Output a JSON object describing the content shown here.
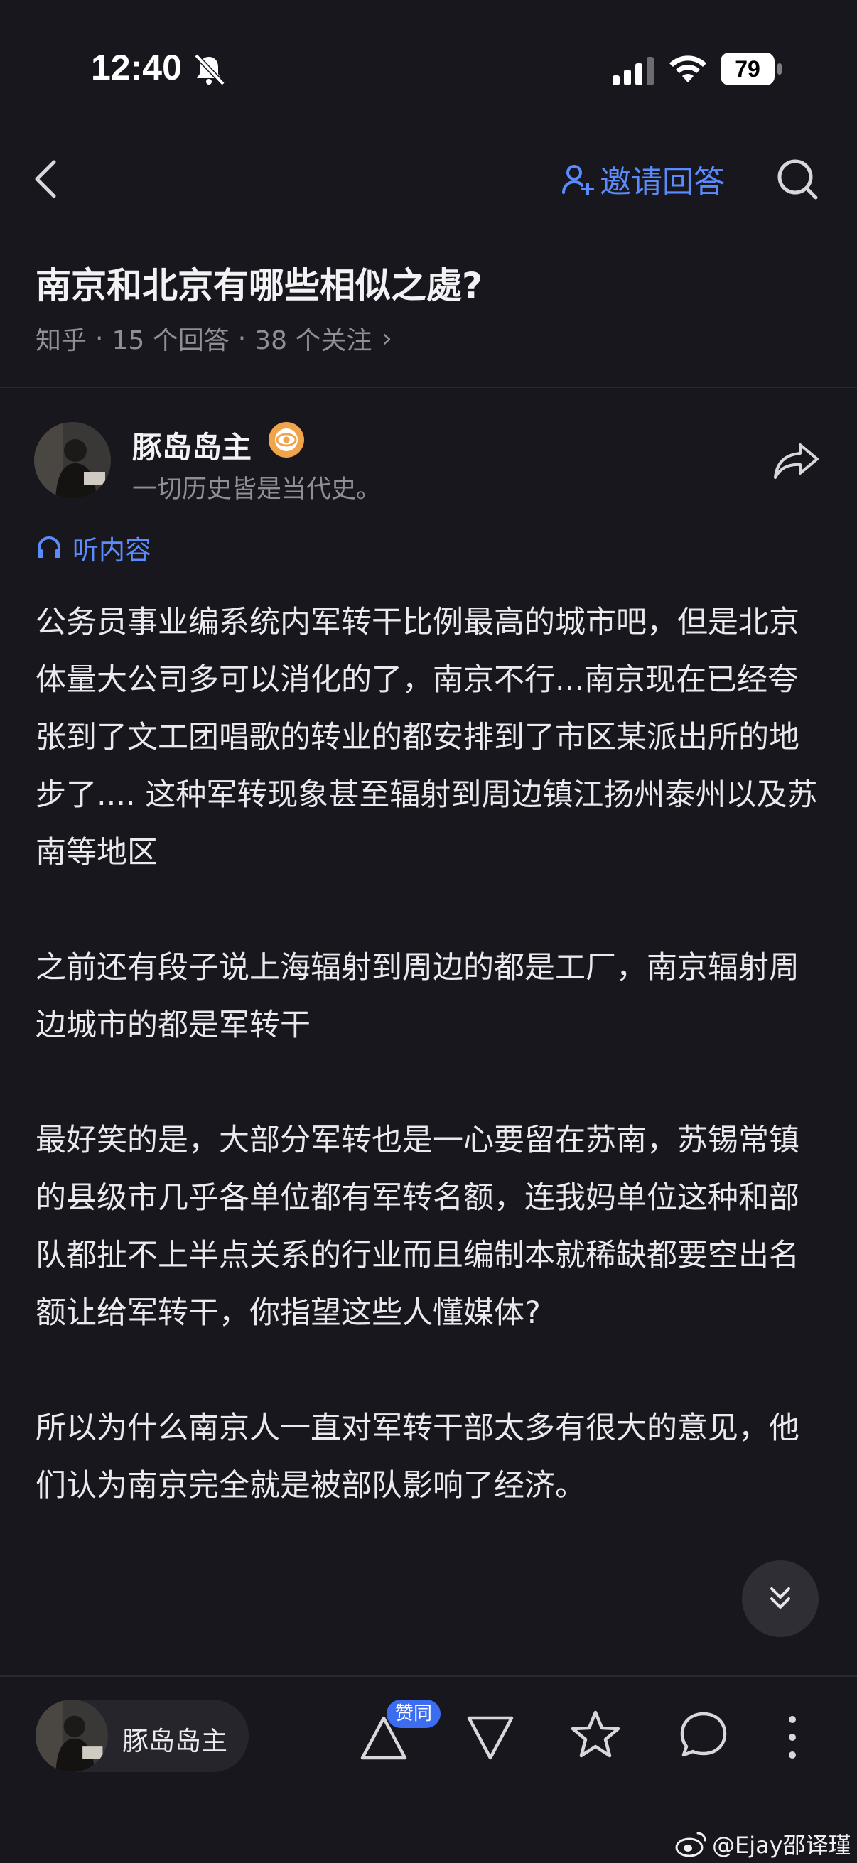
{
  "status_bar": {
    "time": "12:40",
    "battery": "79"
  },
  "nav": {
    "invite_label": "邀请回答"
  },
  "question": {
    "title": "南京和北京有哪些相似之處?",
    "source": "知乎",
    "answers": "15 个回答",
    "followers": "38 个关注",
    "chevron": "›"
  },
  "author": {
    "name": "豚岛岛主",
    "bio": "一切历史皆是当代史。"
  },
  "listen_label": "听内容",
  "answer": {
    "paragraphs": [
      "公务员事业编系统内军转干比例最高的城市吧，但是北京体量大公司多可以消化的了，南京不行...南京现在已经夸张到了文工团唱歌的转业的都安排到了市区某派出所的地步了.... 这种军转现象甚至辐射到周边镇江扬州泰州以及苏南等地区",
      "之前还有段子说上海辐射到周边的都是工厂，南京辐射周边城市的都是军转干",
      "最好笑的是，大部分军转也是一心要留在苏南，苏锡常镇的县级市几乎各单位都有军转名额，连我妈单位这种和部队都扯不上半点关系的行业而且编制本就稀缺都要空出名额让给军转干，你指望这些人懂媒体?",
      "所以为什么南京人一直对军转干部太多有很大的意见，他们认为南京完全就是被部队影响了经济。"
    ]
  },
  "bottom_bar": {
    "author_name": "豚岛岛主",
    "upvote_badge": "赞同"
  },
  "watermark": "@Ejay邵译瑾",
  "colors": {
    "background": "#18171d",
    "accent": "#5b8cff",
    "badge": "#3c6cf0"
  }
}
